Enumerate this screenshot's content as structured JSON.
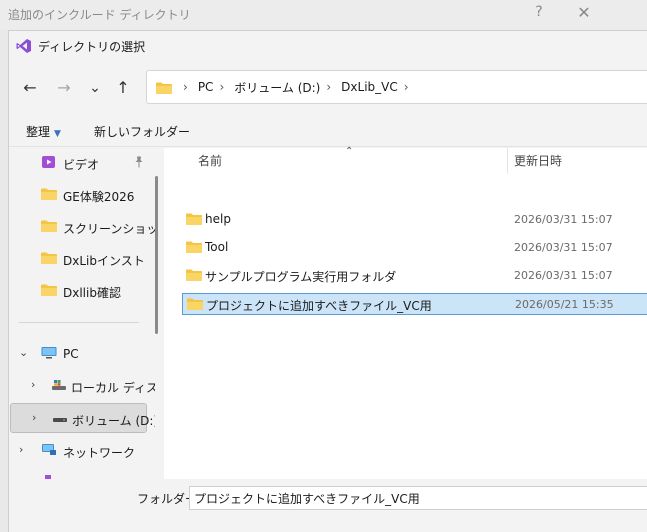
{
  "background_dialog": {
    "title": "追加のインクルード ディレクトリ",
    "help_glyph": "?",
    "close_glyph": "✕"
  },
  "dialog": {
    "title": "ディレクトリの選択",
    "icon": "visual-studio-icon"
  },
  "nav": {
    "back_glyph": "←",
    "forward_glyph": "→",
    "recent_glyph": "⌄",
    "up_glyph": "↑"
  },
  "address": {
    "crumbs": [
      "PC",
      "ボリューム (D:)",
      "DxLib_VC"
    ],
    "separator": "›"
  },
  "commands": {
    "organize": "整理",
    "new_folder": "新しいフォルダー"
  },
  "nav_pane": {
    "items": [
      {
        "label": "ビデオ",
        "icon": "video-icon",
        "pinned": true
      },
      {
        "label": "GE体験2026",
        "icon": "folder-icon"
      },
      {
        "label": "スクリーンショット",
        "icon": "folder-icon"
      },
      {
        "label": "DxLibインスト",
        "icon": "folder-icon"
      },
      {
        "label": "Dxllib確認",
        "icon": "folder-icon"
      },
      {
        "label": "PC",
        "icon": "pc-icon",
        "expanded": true
      },
      {
        "label": "ローカル ディスク",
        "icon": "drive-icon"
      },
      {
        "label": "ボリューム (D:)",
        "icon": "drive-icon",
        "selected": true
      },
      {
        "label": "ネットワーク",
        "icon": "network-icon"
      }
    ]
  },
  "file_list": {
    "columns": {
      "name": "名前",
      "date": "更新日時"
    },
    "rows": [
      {
        "name": "help",
        "date": "2026/03/31 15:07"
      },
      {
        "name": "Tool",
        "date": "2026/03/31 15:07"
      },
      {
        "name": "サンプルプログラム実行用フォルダ",
        "date": "2026/03/31 15:07"
      },
      {
        "name": "プロジェクトに追加すべきファイル_VC用",
        "date": "2026/05/21 15:35",
        "selected": true
      }
    ]
  },
  "footer": {
    "folder_label": "フォルダー:",
    "folder_value": "プロジェクトに追加すべきファイル_VC用"
  },
  "colors": {
    "folder": "#f4c542",
    "selection_bg": "#cce4f7",
    "selection_border": "#5b9bd5",
    "accent": "#3a6fc4"
  }
}
